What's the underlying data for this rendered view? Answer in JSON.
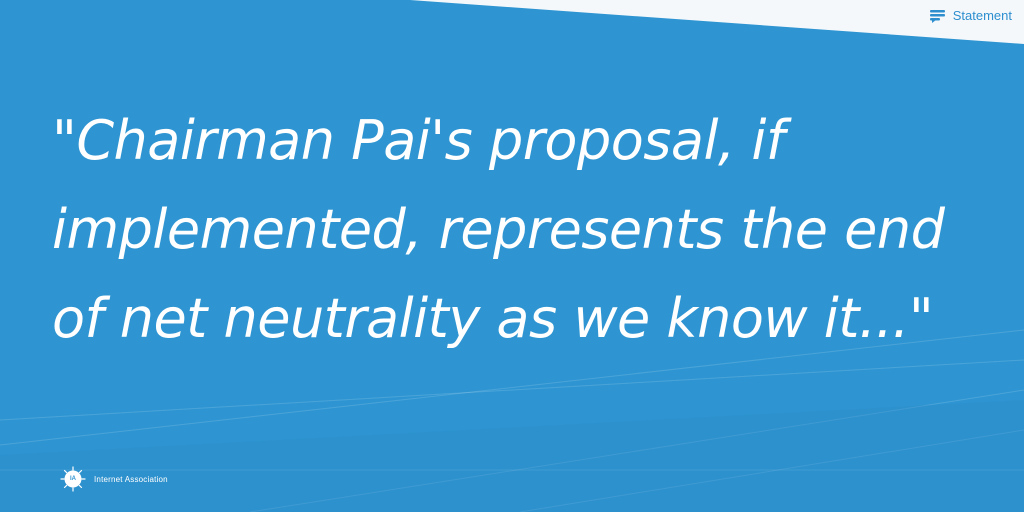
{
  "tag": {
    "label": "Statement",
    "icon": "speech-bubble-lines-icon"
  },
  "quote": {
    "text": "\"Chairman Pai's proposal, if implemented, represents the end of net neutrality as we know it...\""
  },
  "brand": {
    "logo_text": "IA",
    "name": "Internet Association"
  },
  "colors": {
    "background": "#2e95d2",
    "corner": "#f5f8fb",
    "accent": "#2e8fcf",
    "text": "#ffffff"
  }
}
